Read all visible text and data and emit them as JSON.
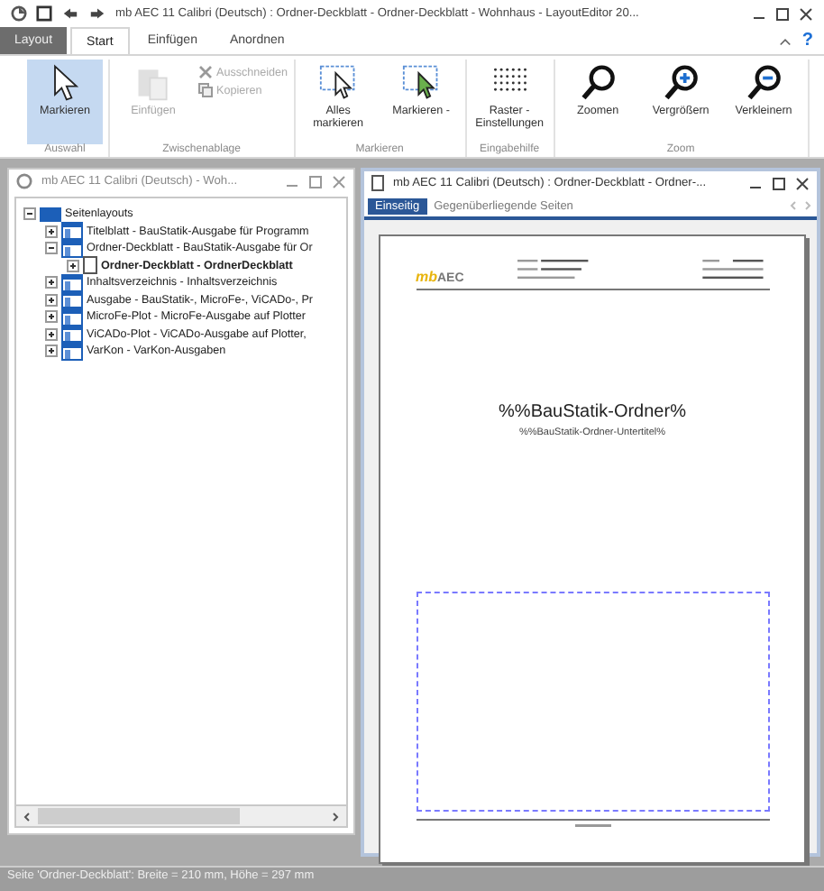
{
  "window": {
    "title": "mb AEC 11 Calibri (Deutsch) : Ordner-Deckblatt - Ordner-Deckblatt - Wohnhaus - LayoutEditor 20..."
  },
  "ribbon_tabs": [
    {
      "label": "Layout",
      "kind": "file",
      "selected": false
    },
    {
      "label": "Start",
      "kind": "tab",
      "selected": true
    },
    {
      "label": "Einfügen",
      "kind": "tab",
      "selected": false
    },
    {
      "label": "Anordnen",
      "kind": "tab",
      "selected": false
    }
  ],
  "help": "?",
  "groups": [
    {
      "label": "Auswahl",
      "buttons": [
        {
          "label": "Markieren",
          "kind": "pointer",
          "disabled": false,
          "selected": true
        }
      ]
    },
    {
      "label": "Zwischenablage",
      "buttons": [
        {
          "label": "Einfügen",
          "kind": "paste",
          "disabled": true,
          "selected": false
        },
        {
          "label": "Ausschneiden",
          "kind": "cut",
          "disabled": true,
          "selected": false
        },
        {
          "label": "Kopieren",
          "kind": "copy",
          "disabled": true,
          "selected": false
        }
      ]
    },
    {
      "label": "Markieren",
      "buttons": [
        {
          "label": "Alles markieren",
          "kind": "selectall",
          "disabled": false,
          "selected": false
        },
        {
          "label": "Markieren -",
          "kind": "selectgreen",
          "disabled": false,
          "selected": false
        }
      ]
    },
    {
      "label": "Eingabehilfe",
      "buttons": [
        {
          "label": "Raster - Einstellungen",
          "kind": "grid",
          "disabled": false,
          "selected": false
        }
      ]
    },
    {
      "label": "Zoom",
      "buttons": [
        {
          "label": "Zoomen",
          "kind": "zoom",
          "disabled": false,
          "selected": false
        },
        {
          "label": "Vergrößern",
          "kind": "zoomin",
          "disabled": false,
          "selected": false
        },
        {
          "label": "Verkleinern",
          "kind": "zoomout",
          "disabled": false,
          "selected": false
        }
      ]
    }
  ],
  "tree_panel": {
    "title": "mb AEC 11 Calibri (Deutsch) - Woh...",
    "tree": [
      {
        "label": "Seitenlayouts",
        "kind": "folder",
        "expanded": true,
        "selected": false,
        "children": [
          {
            "label": "Titelblatt - BauStatik-Ausgabe für Programm",
            "kind": "layout",
            "expanded": false,
            "selected": false
          },
          {
            "label": "Ordner-Deckblatt - BauStatik-Ausgabe für Or",
            "kind": "layout",
            "expanded": true,
            "selected": false,
            "children": [
              {
                "label": "Ordner-Deckblatt - OrdnerDeckblatt",
                "kind": "page",
                "expanded": false,
                "selected": true
              }
            ]
          },
          {
            "label": "Inhaltsverzeichnis - Inhaltsverzeichnis",
            "kind": "layout",
            "expanded": false,
            "selected": false
          },
          {
            "label": "Ausgabe - BauStatik-, MicroFe-, ViCADo-, Pr",
            "kind": "layout",
            "expanded": false,
            "selected": false
          },
          {
            "label": "MicroFe-Plot - MicroFe-Ausgabe auf Plotter",
            "kind": "layout",
            "expanded": false,
            "selected": false
          },
          {
            "label": "ViCADo-Plot - ViCADo-Ausgabe auf Plotter,",
            "kind": "layout",
            "expanded": false,
            "selected": false
          },
          {
            "label": "VarKon - VarKon-Ausgaben",
            "kind": "layout",
            "expanded": false,
            "selected": false
          }
        ]
      }
    ]
  },
  "page_panel": {
    "title": "mb AEC 11 Calibri (Deutsch) : Ordner-Deckblatt - Ordner-...",
    "tabs": [
      {
        "label": "Einseitig",
        "selected": true
      },
      {
        "label": "Gegenüberliegende Seiten",
        "selected": false
      }
    ],
    "page": {
      "logo_mark": "mb",
      "logo_text": "AEC",
      "heading": "%%BauStatik-Ordner%",
      "subheading": "%%BauStatik-Ordner-Untertitel%"
    }
  },
  "status_bar": "Seite 'Ordner-Deckblatt': Breite = 210 mm, Höhe = 297 mm"
}
